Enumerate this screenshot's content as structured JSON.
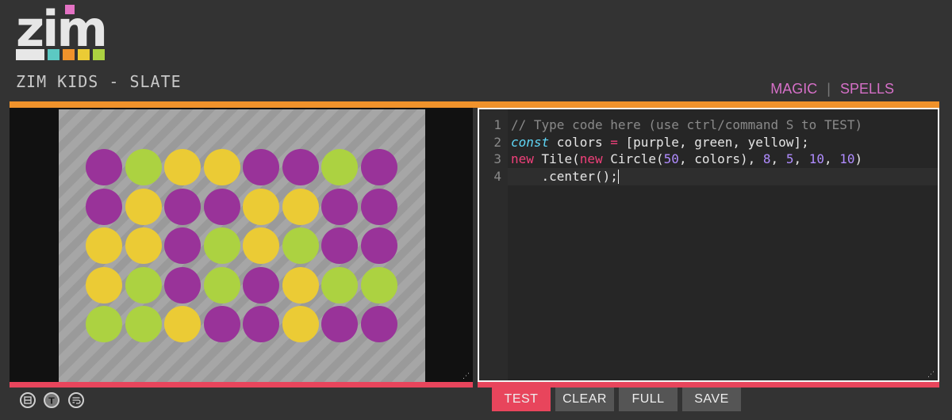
{
  "app": {
    "title": "ZIM KIDS - SLATE",
    "logo_text": "zim"
  },
  "top_links": {
    "magic": "MAGIC",
    "separator": "|",
    "spells": "SPELLS"
  },
  "editor": {
    "line_numbers": [
      "1",
      "2",
      "3",
      "4"
    ],
    "lines": [
      [
        {
          "text": "// Type code here (use ctrl/command S to TEST)",
          "kind": "comment"
        }
      ],
      [
        {
          "text": "const",
          "kind": "keyword-italic"
        },
        {
          "text": " colors ",
          "kind": "plain"
        },
        {
          "text": "=",
          "kind": "operator"
        },
        {
          "text": " [purple, green, yellow];",
          "kind": "plain"
        }
      ],
      [
        {
          "text": "new",
          "kind": "new"
        },
        {
          "text": " Tile(",
          "kind": "plain"
        },
        {
          "text": "new",
          "kind": "new"
        },
        {
          "text": " Circle(",
          "kind": "plain"
        },
        {
          "text": "50",
          "kind": "number"
        },
        {
          "text": ", colors), ",
          "kind": "plain"
        },
        {
          "text": "8",
          "kind": "number"
        },
        {
          "text": ", ",
          "kind": "plain"
        },
        {
          "text": "5",
          "kind": "number"
        },
        {
          "text": ", ",
          "kind": "plain"
        },
        {
          "text": "10",
          "kind": "number"
        },
        {
          "text": ", ",
          "kind": "plain"
        },
        {
          "text": "10",
          "kind": "number"
        },
        {
          "text": ")",
          "kind": "plain"
        }
      ],
      [
        {
          "text": "    .center();",
          "kind": "plain"
        }
      ]
    ],
    "syntax_colors": {
      "comment": "#8a8a8a",
      "keyword-italic": "#5fd7f7",
      "operator": "#f0407a",
      "new": "#f0407a",
      "number": "#b08cff",
      "plain": "#e6e6e6"
    }
  },
  "stage": {
    "tile_colors": {
      "purple": "#993399",
      "green": "#acd241",
      "yellow": "#ebcb35"
    },
    "grid": [
      [
        "purple",
        "green",
        "yellow",
        "yellow",
        "purple",
        "purple",
        "green",
        "purple"
      ],
      [
        "purple",
        "yellow",
        "purple",
        "purple",
        "yellow",
        "yellow",
        "purple",
        "purple"
      ],
      [
        "yellow",
        "yellow",
        "purple",
        "green",
        "yellow",
        "green",
        "purple",
        "purple"
      ],
      [
        "yellow",
        "green",
        "purple",
        "green",
        "purple",
        "yellow",
        "green",
        "green"
      ],
      [
        "green",
        "green",
        "yellow",
        "purple",
        "purple",
        "yellow",
        "purple",
        "purple"
      ]
    ]
  },
  "bottom_icons": [
    "split-view-icon",
    "text-size-icon",
    "word-wrap-icon"
  ],
  "buttons": {
    "test": "TEST",
    "clear": "CLEAR",
    "full": "FULL",
    "save": "SAVE"
  },
  "colors": {
    "accent_orange": "#f0922b",
    "accent_pink": "#e8455c",
    "link_pink": "#d670c8",
    "button_gray": "#555555",
    "logo_bar_colors": [
      "#e7e7e7",
      "#5cc9c3",
      "#f0922b",
      "#ebcb35",
      "#acd241"
    ]
  }
}
